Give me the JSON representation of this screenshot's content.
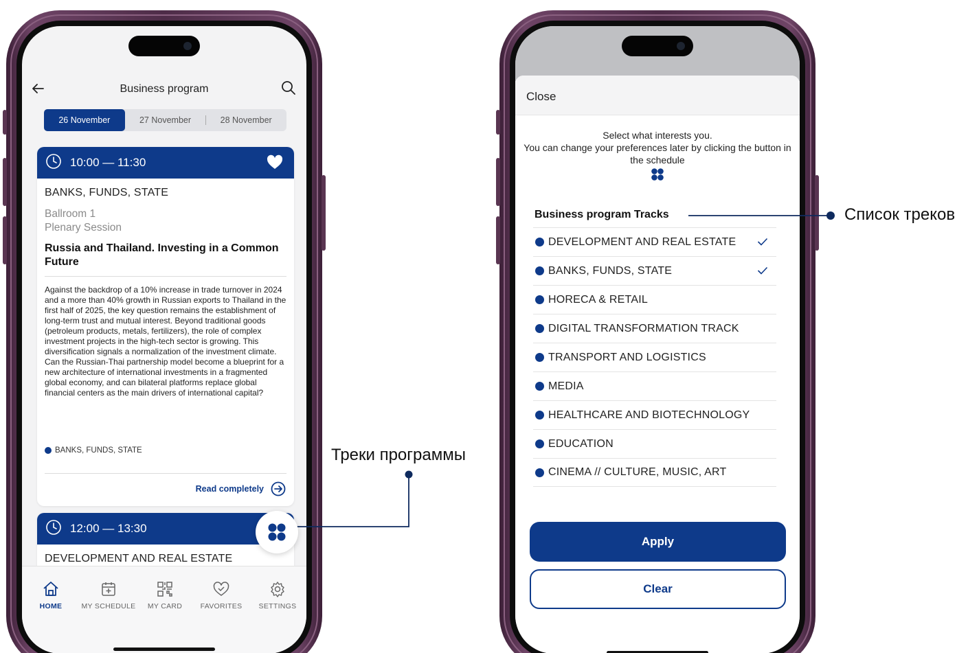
{
  "colors": {
    "brand": "#0e3a8a",
    "frame": "#5a3552"
  },
  "left_screen": {
    "header": {
      "title": "Business program"
    },
    "date_tabs": [
      {
        "label": "26 November",
        "active": true
      },
      {
        "label": "27 November",
        "active": false
      },
      {
        "label": "28 November",
        "active": false
      }
    ],
    "session1": {
      "time": "10:00 — 11:30",
      "favorite": true,
      "track": "BANKS, FUNDS, STATE",
      "room": "Ballroom 1",
      "format": "Plenary Session",
      "title": "Russia and Thailand. Investing in a Common Future",
      "description": "Against the backdrop of a 10% increase in trade turnover in 2024 and a more than 40% growth in Russian exports to Thailand in the first half of 2025, the key question remains the establishment of long-term trust and mutual interest. Beyond traditional goods (petroleum products, metals, fertilizers), the role of complex investment projects in the high-tech sector is growing. This diversification signals a normalization of the investment climate. Can the Russian-Thai partnership model become a blueprint for a new architecture of international investments in a fragmented global economy, and can bilateral platforms replace global financial centers as the main drivers of international capital?",
      "tag": "BANKS, FUNDS, STATE",
      "read_more": "Read completely"
    },
    "session2": {
      "time": "12:00 — 13:30",
      "track": "DEVELOPMENT AND REAL ESTATE"
    },
    "nav": [
      {
        "label": "HOME",
        "icon": "home-icon",
        "active": true
      },
      {
        "label": "MY SCHEDULE",
        "icon": "calendar-icon",
        "active": false
      },
      {
        "label": "MY CARD",
        "icon": "qr-code-icon",
        "active": false
      },
      {
        "label": "FAVORITES",
        "icon": "heart-icon",
        "active": false
      },
      {
        "label": "SETTINGS",
        "icon": "gear-icon",
        "active": false
      }
    ]
  },
  "right_screen": {
    "close_label": "Close",
    "intro_line1": "Select what interests you.",
    "intro_line2": "You can change your preferences later by clicking the button in the schedule",
    "tracks_heading": "Business program Tracks",
    "tracks": [
      {
        "label": "DEVELOPMENT AND REAL ESTATE",
        "checked": true
      },
      {
        "label": "BANKS, FUNDS, STATE",
        "checked": true
      },
      {
        "label": "HORECA & RETAIL",
        "checked": false
      },
      {
        "label": "DIGITAL TRANSFORMATION TRACK",
        "checked": false
      },
      {
        "label": "TRANSPORT AND LOGISTICS",
        "checked": false
      },
      {
        "label": "MEDIA",
        "checked": false
      },
      {
        "label": "HEALTHCARE AND BIOTECHNOLOGY",
        "checked": false
      },
      {
        "label": "EDUCATION",
        "checked": false
      },
      {
        "label": "CINEMA // CULTURE, MUSIC, ART",
        "checked": false
      }
    ],
    "apply_label": "Apply",
    "clear_label": "Clear"
  },
  "callouts": {
    "program_tracks": "Треки программы",
    "tracks_list": "Список треков"
  }
}
